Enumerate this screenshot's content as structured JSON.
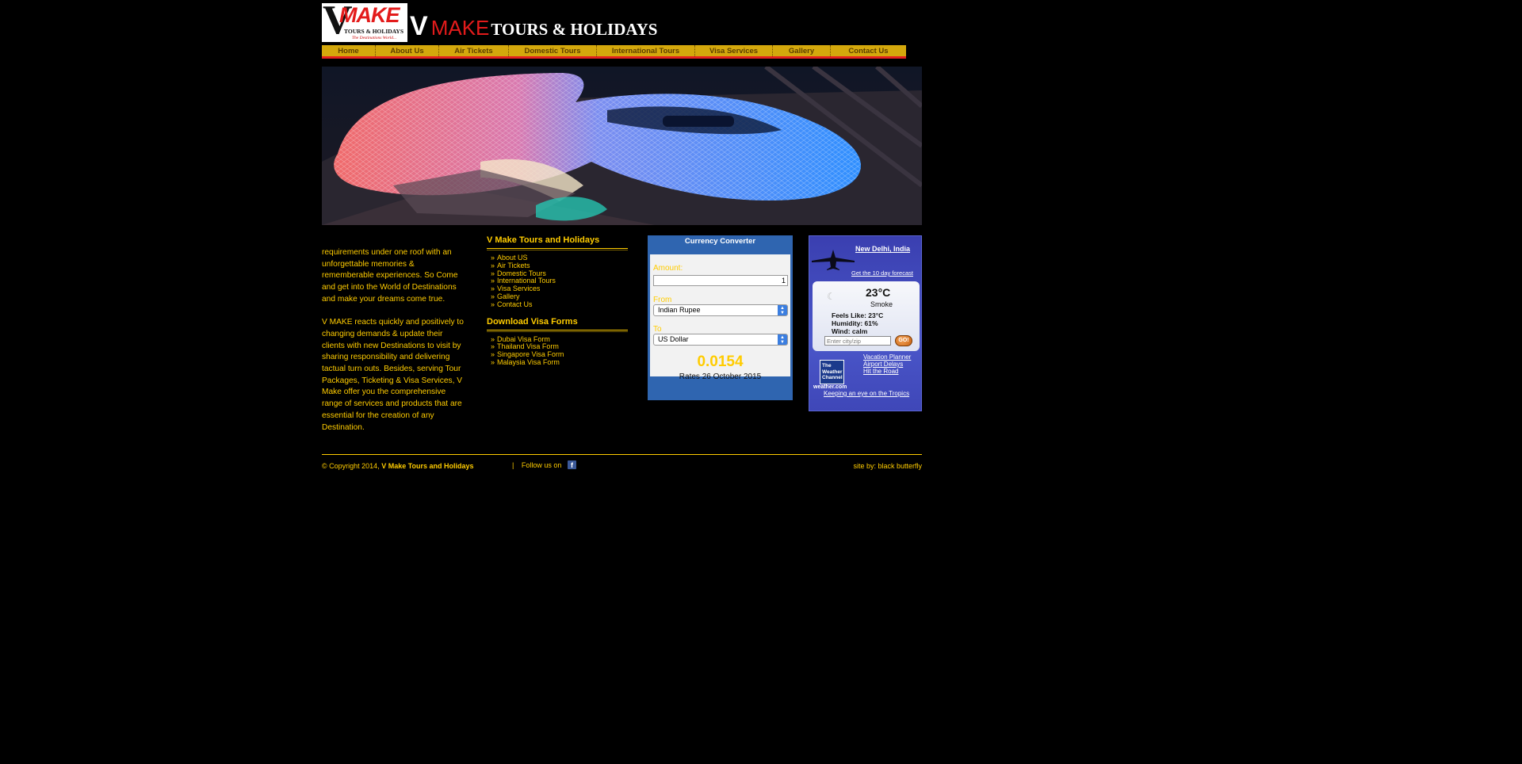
{
  "header": {
    "logo": {
      "letter": "V",
      "make": "MAKE",
      "sub": "TOURS & HOLIDAYS",
      "tagline": "The Destinations World..."
    },
    "title_v": "V",
    "title_make": "MAKE",
    "title_rest": "TOURS & HOLIDAYS"
  },
  "nav": {
    "items": [
      "Home",
      "About Us",
      "Air Tickets",
      "Domestic Tours",
      "International Tours",
      "Visa Services",
      "Gallery",
      "Contact Us"
    ]
  },
  "about": {
    "paragraph1": "requirements under one roof with an unforgettable memories & rememberable experiences. So Come and get into the World of Destinations and make your dreams come true.",
    "paragraph2": "V MAKE reacts quickly and positively to changing demands & update their clients with new Destinations to visit by sharing responsibility and delivering tactual turn outs. Besides, serving Tour Packages, Ticketing & Visa Services, V Make offer you the comprehensive range of services and products that are essential for the creation of any Destination."
  },
  "links": {
    "heading": "V Make Tours and Holidays",
    "arrow": "»",
    "items": [
      "About US",
      "Air Tickets",
      "Domestic Tours",
      "International Tours",
      "Visa Services",
      "Gallery",
      "Contact Us"
    ]
  },
  "visa_forms": {
    "heading": "Download Visa Forms",
    "items": [
      "Dubai Visa Form",
      "Thailand Visa Form",
      "Singapore Visa Form",
      "Malaysia Visa Form"
    ]
  },
  "currency_converter": {
    "title": "Currency Converter",
    "amount_label": "Amount:",
    "amount_value": "1",
    "from_label": "From",
    "from_value": "Indian Rupee",
    "to_label": "To",
    "to_value": "US Dollar",
    "result": "0.0154",
    "rates": "Rates 26 October 2015"
  },
  "weather": {
    "city": "New Delhi, India",
    "forecast_link": "Get the 10 day forecast",
    "temperature": "23°C",
    "condition": "Smoke",
    "feels_like": "Feels Like: 23°C",
    "humidity": "Humidity: 61%",
    "wind": "Wind: calm",
    "input_placeholder": "Enter city/zip",
    "go_label": "GO!",
    "logo_text": "The Weather Channel",
    "logo_url": "weather.com",
    "links": [
      "Vacation Planner",
      "Airport Delays",
      "Hit the Road"
    ],
    "tropics_link": "Keeping an eye on the Tropics"
  },
  "footer": {
    "copyright_prefix": "© Copyright 2014,",
    "copyright_name": "V Make Tours and Holidays",
    "separator": "|",
    "follow": "Follow us on",
    "facebook_letter": "f",
    "site_by": "site by: black butterfly"
  },
  "colors": {
    "background": "#000000",
    "accent_text": "#ffcc00",
    "nav_bar": "#d4a80c",
    "nav_underline": "#e32020",
    "brand_red": "#e31b1b",
    "converter_blue": "#2f65b0",
    "weather_blue": "#3a3fb0"
  }
}
